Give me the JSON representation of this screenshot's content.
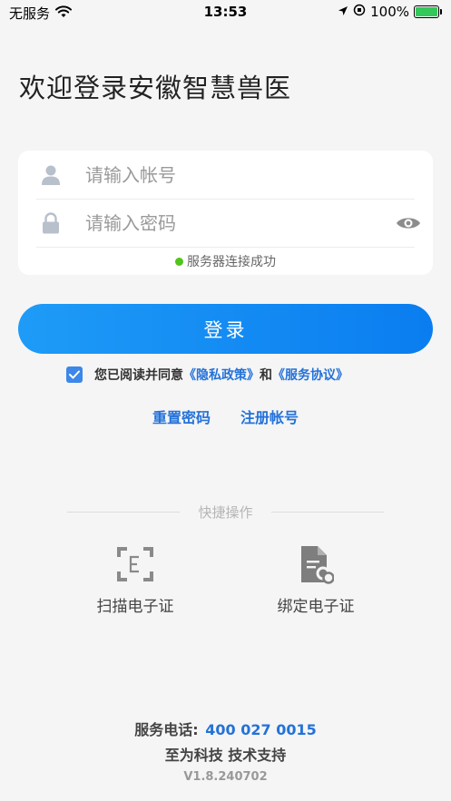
{
  "status_bar": {
    "carrier": "无服务",
    "time": "13:53",
    "battery_percent": "100%"
  },
  "title": "欢迎登录安徽智慧兽医",
  "form": {
    "account_placeholder": "请输入帐号",
    "password_placeholder": "请输入密码",
    "server_status": "服务器连接成功"
  },
  "login_button": "登录",
  "agreement": {
    "prefix": "您已阅读并同意",
    "privacy_link": "《隐私政策》",
    "and": "和",
    "service_link": "《服务协议》",
    "checked": true
  },
  "links": {
    "reset_password": "重置密码",
    "register": "注册帐号"
  },
  "quick_actions": {
    "title": "快捷操作",
    "scan_label": "扫描电子证",
    "bind_label": "绑定电子证"
  },
  "footer": {
    "phone_label": "服务电话:",
    "phone_number": "400 027 0015",
    "support": "至为科技 技术支持",
    "version": "V1.8.240702"
  },
  "colors": {
    "accent": "#2372d9",
    "button_start": "#1e9bf7",
    "button_end": "#0a7df0",
    "status_ok": "#52c41a"
  }
}
